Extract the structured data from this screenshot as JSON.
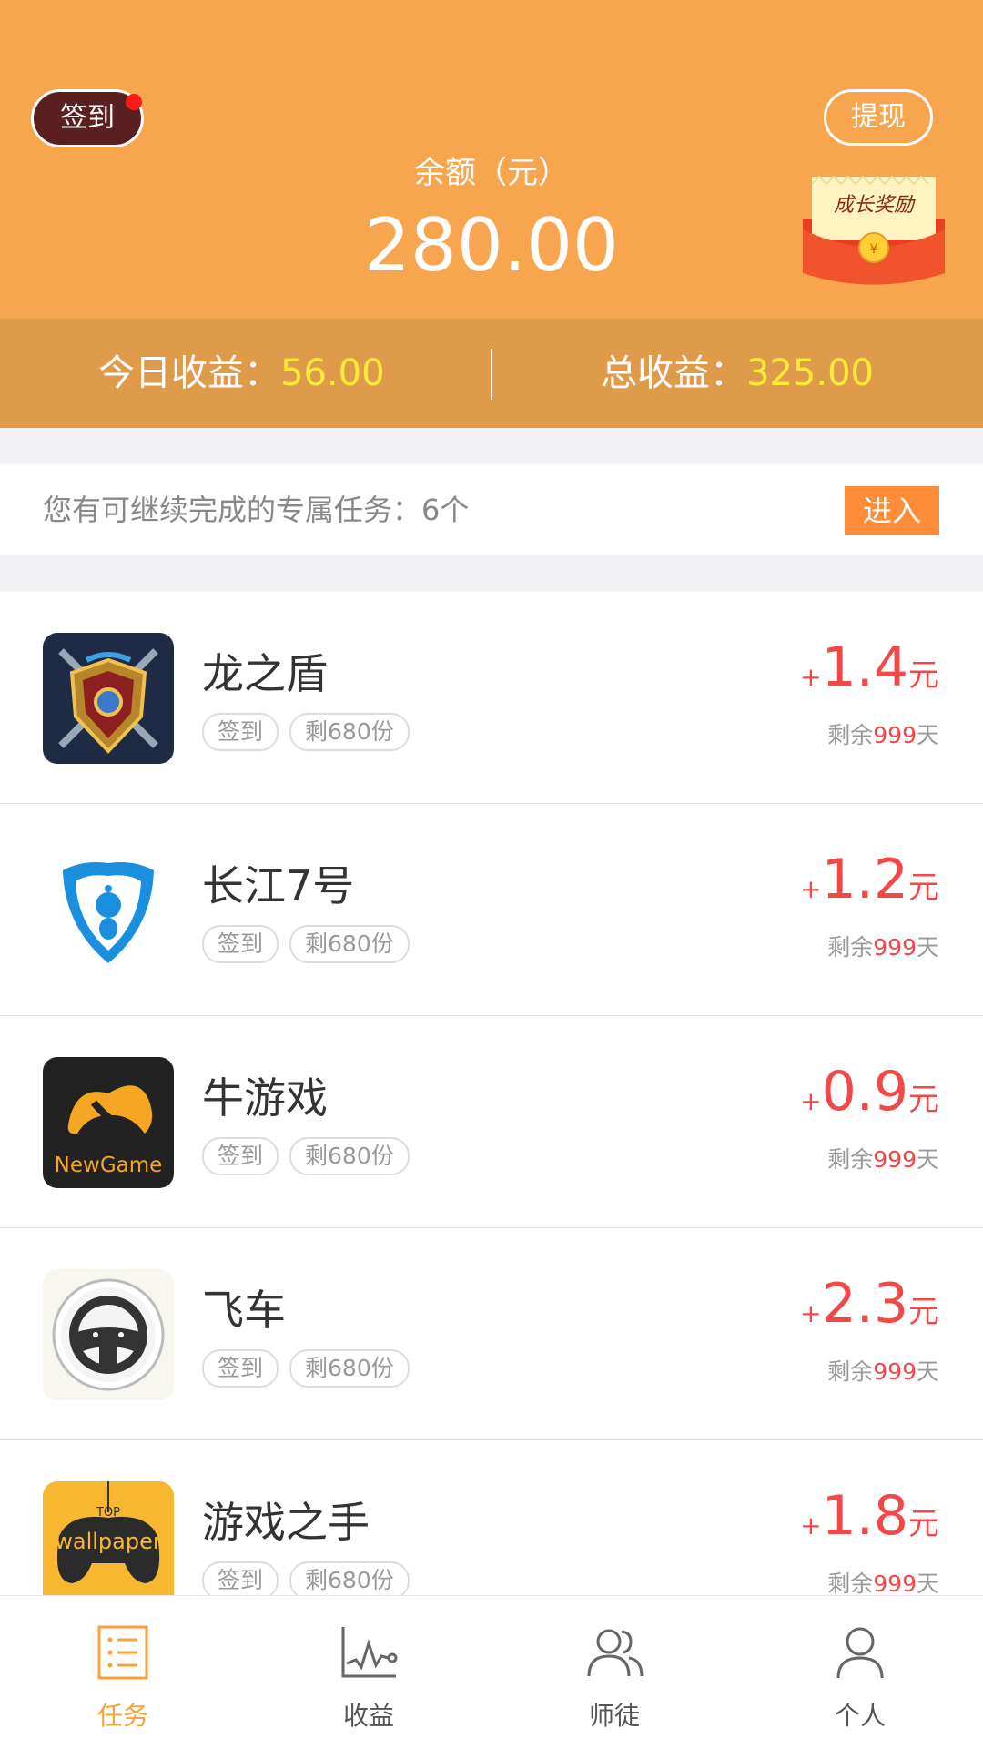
{
  "header": {
    "checkin_label": "签到",
    "withdraw_label": "提现",
    "balance_label": "余额（元）",
    "balance_value": "280.00",
    "redpack_text": "成长奖励",
    "today_label": "今日收益：",
    "today_value": "56.00",
    "total_label": "总收益：",
    "total_value": "325.00"
  },
  "notice": {
    "text": "您有可继续完成的专属任务：6个",
    "button": "进入"
  },
  "tasks": [
    {
      "name": "龙之盾",
      "tag1": "签到",
      "tag2": "剩680份",
      "plus": "+",
      "amount": "1.4",
      "unit": "元",
      "remain_prefix": "剩余",
      "remain_days": "999",
      "remain_suffix": "天",
      "icon": "dragon-shield-icon"
    },
    {
      "name": "长江7号",
      "tag1": "签到",
      "tag2": "剩680份",
      "plus": "+",
      "amount": "1.2",
      "unit": "元",
      "remain_prefix": "剩余",
      "remain_days": "999",
      "remain_suffix": "天",
      "icon": "blue-shield-icon"
    },
    {
      "name": "牛游戏",
      "tag1": "签到",
      "tag2": "剩680份",
      "plus": "+",
      "amount": "0.9",
      "unit": "元",
      "remain_prefix": "剩余",
      "remain_days": "999",
      "remain_suffix": "天",
      "icon": "newgame-icon",
      "icon_text": "NewGame"
    },
    {
      "name": "飞车",
      "tag1": "签到",
      "tag2": "剩680份",
      "plus": "+",
      "amount": "2.3",
      "unit": "元",
      "remain_prefix": "剩余",
      "remain_days": "999",
      "remain_suffix": "天",
      "icon": "steering-wheel-icon"
    },
    {
      "name": "游戏之手",
      "tag1": "签到",
      "tag2": "剩680份",
      "plus": "+",
      "amount": "1.8",
      "unit": "元",
      "remain_prefix": "剩余",
      "remain_days": "999",
      "remain_suffix": "天",
      "icon": "gamepad-icon",
      "icon_text_top": "TOP",
      "icon_text": "wallpaper"
    }
  ],
  "tabbar": {
    "tabs": [
      {
        "label": "任务",
        "icon": "task-list-icon",
        "active": true
      },
      {
        "label": "收益",
        "icon": "chart-icon",
        "active": false
      },
      {
        "label": "师徒",
        "icon": "users-icon",
        "active": false
      },
      {
        "label": "个人",
        "icon": "person-icon",
        "active": false
      }
    ]
  },
  "colors": {
    "header": "#f7a54f",
    "stats_bar": "#df9a4a",
    "highlight": "#ffeb3b",
    "reward_red": "#f24848",
    "enter_button": "#ff8c39",
    "active_tab": "#f7a23a"
  }
}
